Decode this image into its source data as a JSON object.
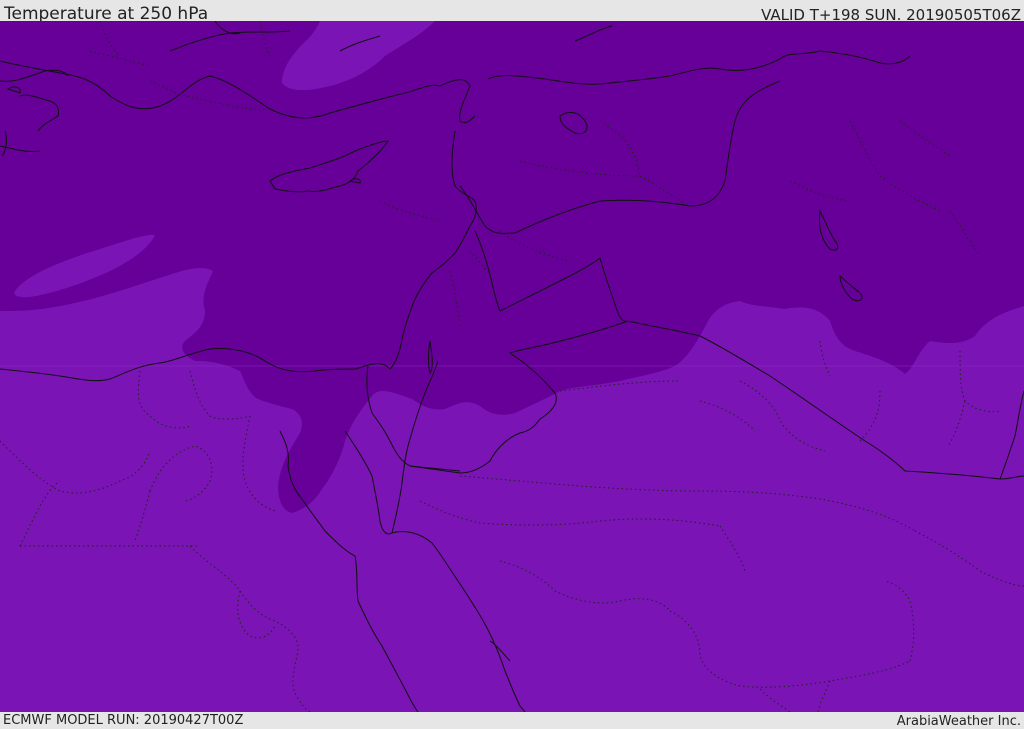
{
  "header": {
    "title": "Temperature at 250 hPa",
    "valid_time": "VALID T+198 SUN. 20190505T06Z"
  },
  "footer": {
    "model_run": "ECMWF MODEL RUN: 20190427T00Z",
    "credit": "ArabiaWeather Inc."
  },
  "map": {
    "variable": "Temperature",
    "level": "250 hPa",
    "colors": {
      "colder_band": "#660099",
      "warmer_band": "#7a14b4",
      "lighter_patch": "#8a2cc6",
      "coastline": "#111111",
      "border": "#111111"
    }
  }
}
